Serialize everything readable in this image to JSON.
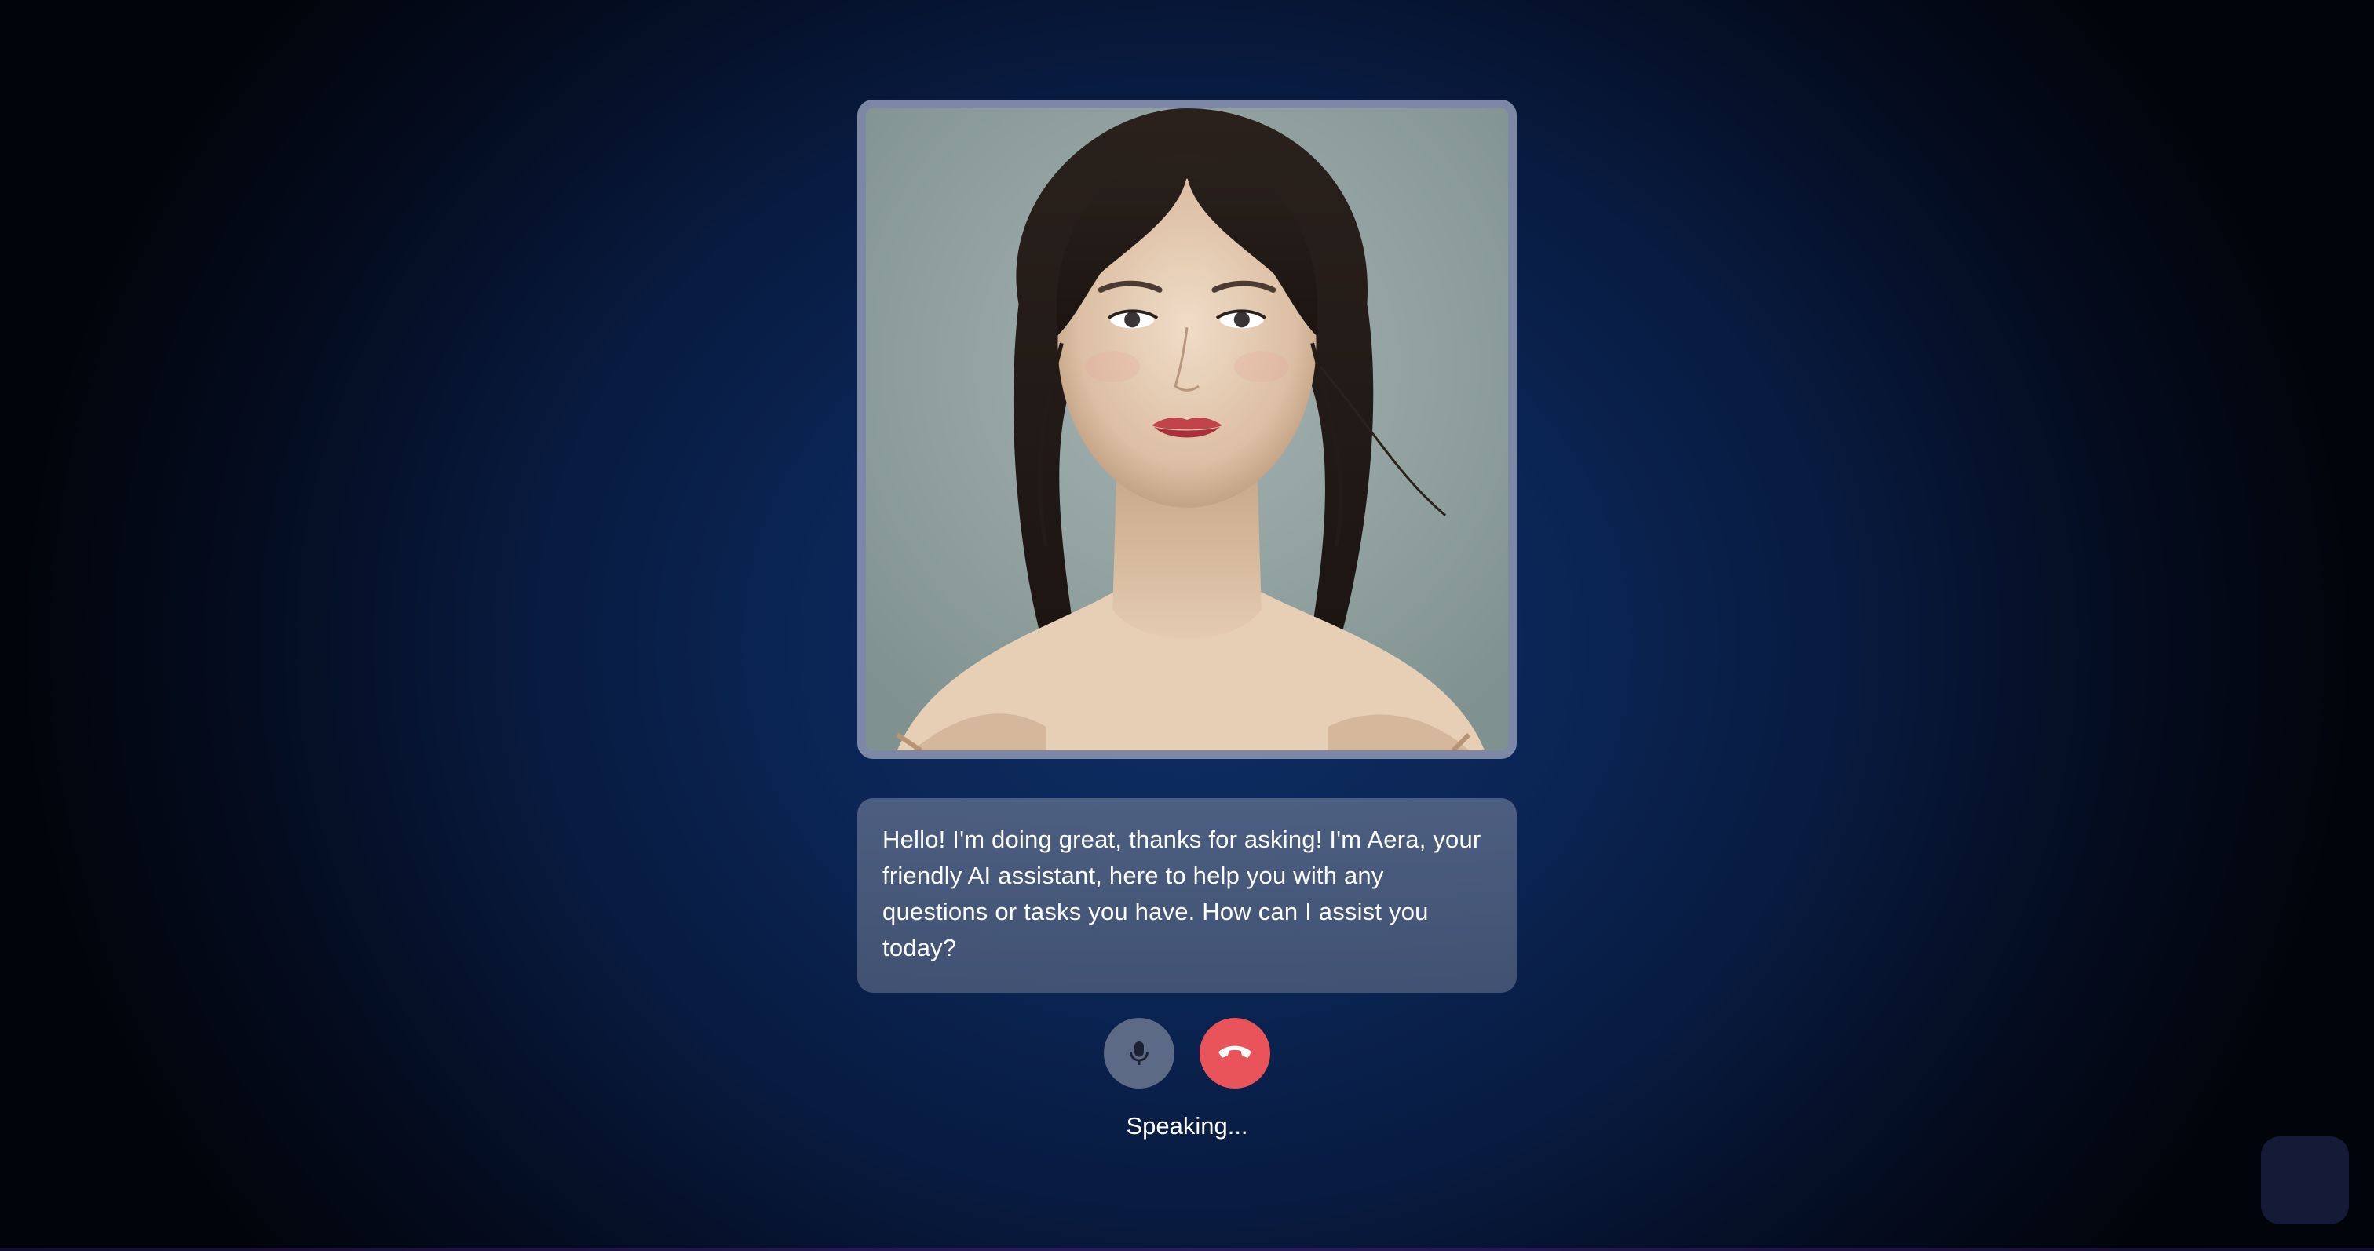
{
  "avatar": {
    "name": "Aera",
    "icon": "ai-avatar-portrait"
  },
  "message": {
    "text": "Hello! I'm doing great, thanks for asking! I'm Aera, your friendly AI assistant, here to help you with any questions or tasks you have. How can I assist you today?"
  },
  "controls": {
    "mic_icon": "microphone-icon",
    "hangup_icon": "phone-hangup-icon",
    "mic_color": "#5c6a85",
    "hangup_color": "#e8545a"
  },
  "status": {
    "text": "Speaking..."
  },
  "theme": {
    "background": "#0b2656",
    "frame_border": "#7d88a6"
  }
}
